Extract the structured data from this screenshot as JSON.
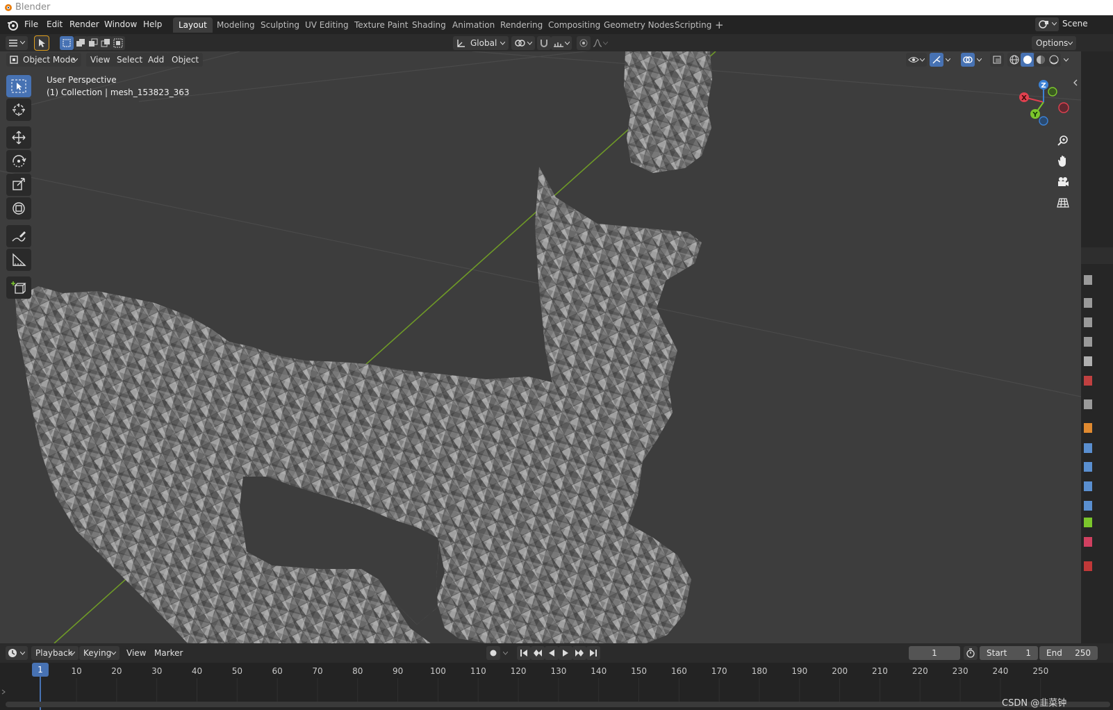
{
  "window": {
    "title": "Blender"
  },
  "menu": [
    "File",
    "Edit",
    "Render",
    "Window",
    "Help"
  ],
  "workspaces": [
    "Layout",
    "Modeling",
    "Sculpting",
    "UV Editing",
    "Texture Paint",
    "Shading",
    "Animation",
    "Rendering",
    "Compositing",
    "Geometry Nodes",
    "Scripting"
  ],
  "workspace_add": "+",
  "scene": {
    "label": "Scene"
  },
  "header": {
    "transform_orientation": "Global",
    "options_label": "Options",
    "mode": "Object Mode",
    "view_menus": [
      "View",
      "Select",
      "Add",
      "Object"
    ]
  },
  "viewport": {
    "perspective_label": "User Perspective",
    "object_label": "(1) Collection | mesh_153823_363",
    "gizmo": {
      "x": "X",
      "y": "Y",
      "z": "Z"
    }
  },
  "colors": {
    "accent": "#4772b3",
    "axis_x": "#e0404f",
    "axis_y": "#7bc62c",
    "axis_z": "#3b82d6",
    "grid_line": "#4a4a4a",
    "mesh": "#8a8a8a"
  },
  "timeline": {
    "menus": [
      "Playback",
      "Keying",
      "View",
      "Marker"
    ],
    "current_frame": "1",
    "start_label": "Start",
    "start_value": "1",
    "end_label": "End",
    "end_value": "250",
    "ruler": [
      "1",
      "10",
      "20",
      "30",
      "40",
      "50",
      "60",
      "70",
      "80",
      "90",
      "100",
      "110",
      "120",
      "130",
      "140",
      "150",
      "160",
      "170",
      "180",
      "190",
      "200",
      "210",
      "220",
      "230",
      "240",
      "250"
    ]
  },
  "watermark": "CSDN @韭菜钟"
}
